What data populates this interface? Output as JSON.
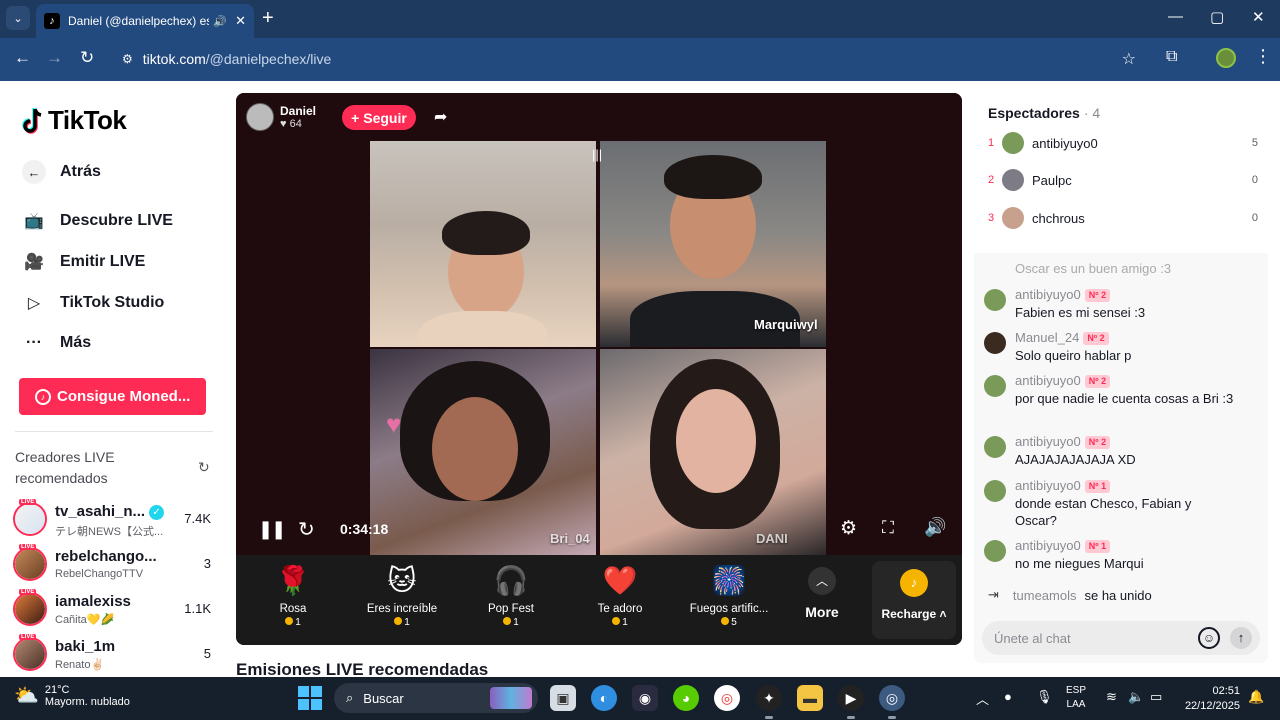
{
  "browser": {
    "tab_title": "Daniel (@danielpechex) está",
    "url_host": "tiktok.com",
    "url_path": "/@danielpechex/live"
  },
  "sidebar": {
    "logo": "TikTok",
    "back_label": "Atrás",
    "nav": [
      {
        "label": "Descubre LIVE",
        "icon": "tv-icon"
      },
      {
        "label": "Emitir LIVE",
        "icon": "camera-icon"
      },
      {
        "label": "TikTok Studio",
        "icon": "studio-icon"
      },
      {
        "label": "Más",
        "icon": "more-dots-icon"
      }
    ],
    "coins_button": "Consigue Moned...",
    "creators_title": "Creadores LIVE recomendados",
    "creators": [
      {
        "name": "tv_asahi_n...",
        "sub": "テレ朝NEWS【公式...",
        "count": "7.4K",
        "verified": true
      },
      {
        "name": "rebelchango...",
        "sub": "RebelChangoTTV",
        "count": "3"
      },
      {
        "name": "iamalexiss",
        "sub": "Cañita💛🌽",
        "count": "1.1K"
      },
      {
        "name": "baki_1m",
        "sub": "Renato✌🏻",
        "count": "5"
      }
    ],
    "live_badge": "LIVE"
  },
  "player": {
    "host_name": "Daniel",
    "host_likes": "64",
    "follow_label": "+ Seguir",
    "time": "0:34:18",
    "guest_labels": [
      "Marquiwyl",
      "Bri_04",
      "DANI"
    ],
    "gifts": [
      {
        "icon": "🌹",
        "name": "Rosa",
        "price": "1"
      },
      {
        "icon": "🐱",
        "name": "Eres increíble",
        "price": "1"
      },
      {
        "icon": "🎧",
        "name": "Pop Fest",
        "price": "1"
      },
      {
        "icon": "❤️",
        "name": "Te adoro",
        "price": "1"
      },
      {
        "icon": "🎆",
        "name": "Fuegos artific...",
        "price": "5"
      }
    ],
    "more_label": "More",
    "recharge_label": "Recharge"
  },
  "recommended_title": "Emisiones LIVE recomendadas",
  "viewers": {
    "title": "Espectadores",
    "count": "· 4",
    "list": [
      {
        "rank": "1",
        "name": "antibiyuyo0",
        "score": "5"
      },
      {
        "rank": "2",
        "name": "Paulpc",
        "score": "0"
      },
      {
        "rank": "3",
        "name": "chchrous",
        "score": "0"
      }
    ]
  },
  "chat": {
    "ghost": "Oscar es un buen amigo :3",
    "messages": [
      {
        "user": "antibiyuyo0",
        "badge": "Nº 2",
        "text": "Fabien es mi sensei :3"
      },
      {
        "user": "Manuel_24",
        "badge": "Nº 2",
        "text": "Solo queiro hablar p"
      },
      {
        "user": "antibiyuyo0",
        "badge": "Nº 2",
        "text": "por que nadie le cuenta cosas a Bri :3"
      },
      {
        "user": "antibiyuyo0",
        "badge": "Nº 2",
        "text": "AJAJAJAJAJAJA XD"
      },
      {
        "user": "antibiyuyo0",
        "badge": "Nº 1",
        "text": "donde estan Chesco, Fabian y Oscar?"
      },
      {
        "user": "antibiyuyo0",
        "badge": "Nº 1",
        "text": "no me niegues Marqui"
      }
    ],
    "joined_user": "tumeamols",
    "joined_text": "se ha unido",
    "input_placeholder": "Únete al chat"
  },
  "taskbar": {
    "temp": "21°C",
    "weather": "Mayorm. nublado",
    "search": "Buscar",
    "lang1": "ESP",
    "lang2": "LAA",
    "time": "02:51",
    "date": "22/12/2025"
  }
}
